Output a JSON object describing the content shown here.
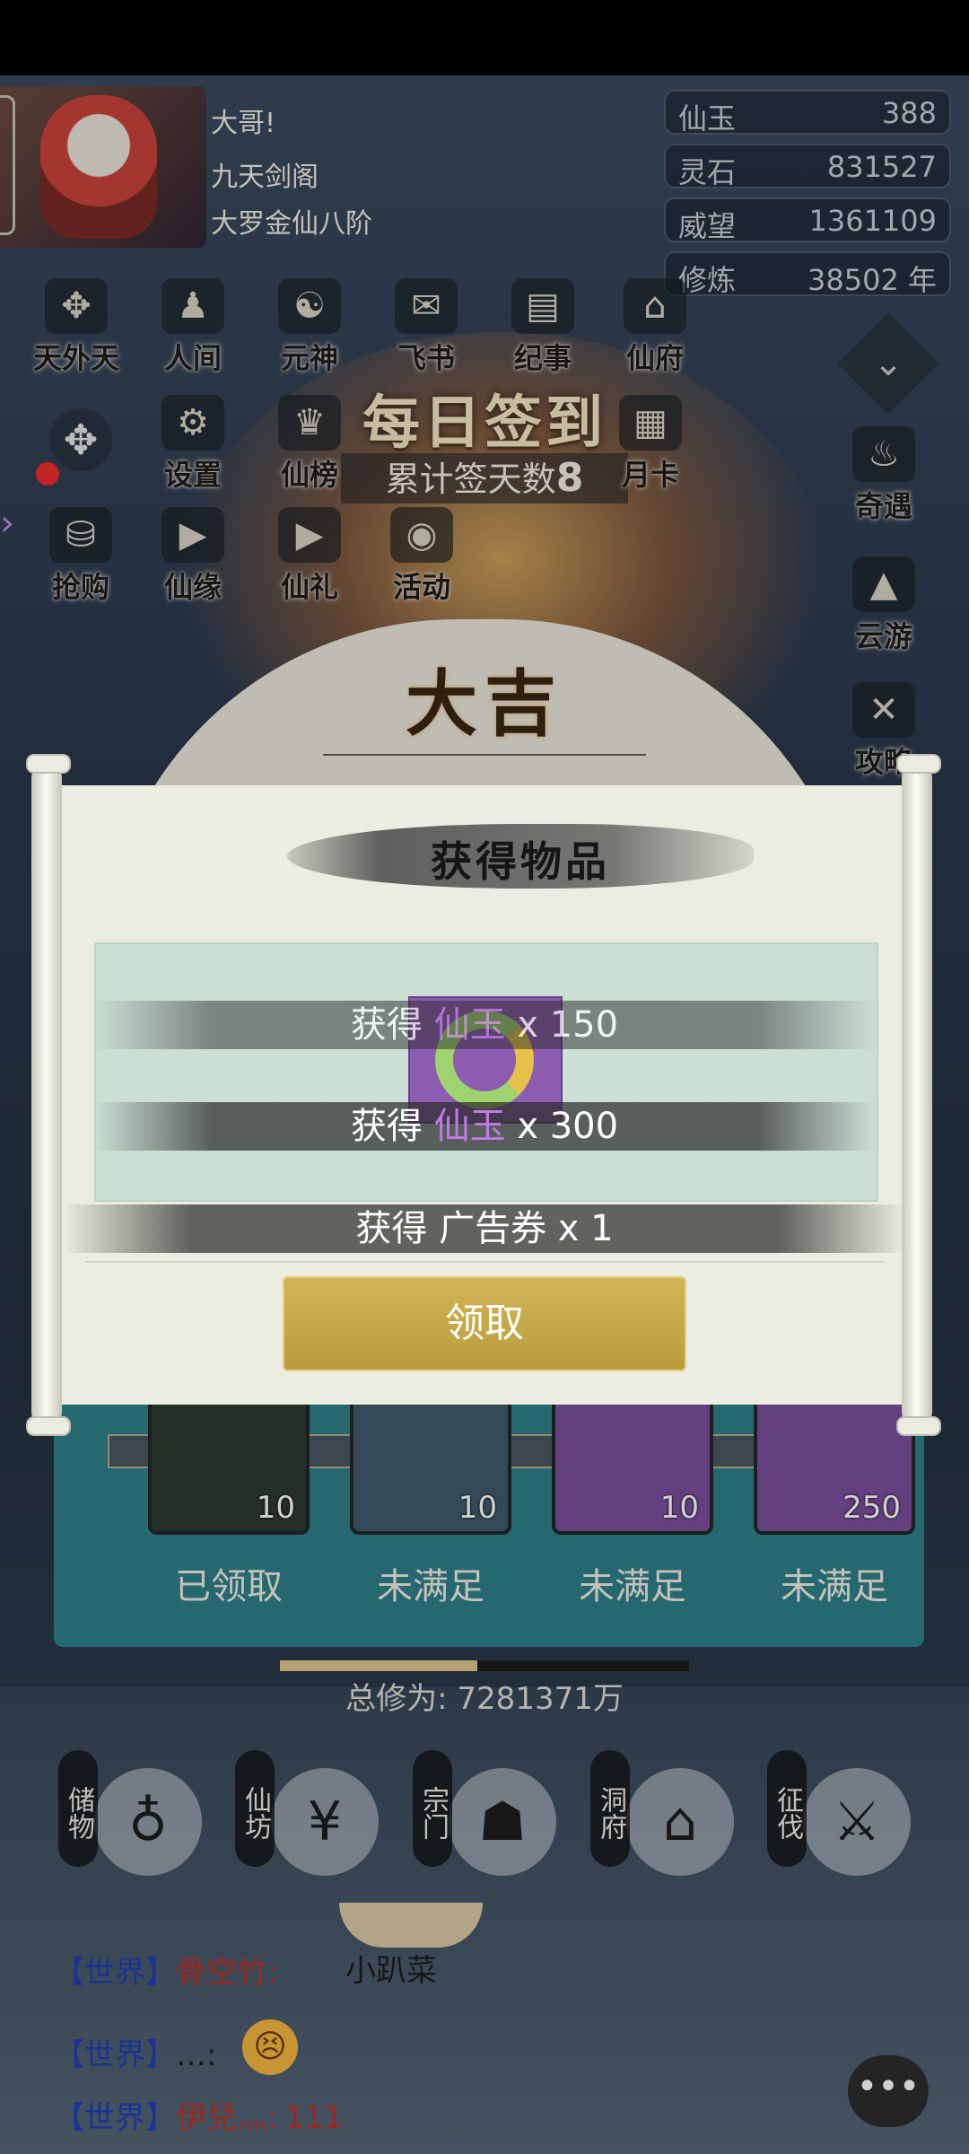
{
  "player": {
    "greeting": "大哥!",
    "sect": "九天剑阁",
    "realm": "大罗金仙八阶"
  },
  "resources": [
    {
      "label": "仙玉",
      "value": "388"
    },
    {
      "label": "灵石",
      "value": "831527"
    },
    {
      "label": "威望",
      "value": "1361109"
    },
    {
      "label": "修炼",
      "value": "38502 年"
    }
  ],
  "menu": {
    "row1": [
      "天外天",
      "人间",
      "元神",
      "飞书",
      "纪事",
      "仙府"
    ],
    "row2": [
      "设置",
      "仙榜",
      "月卡"
    ],
    "row3": [
      "抢购",
      "仙缘",
      "仙礼",
      "活动"
    ],
    "right": [
      "奇遇",
      "云游",
      "攻略"
    ]
  },
  "signin": {
    "title": "每日签到",
    "count_label": "累计签天数",
    "count": "8",
    "fortune": "大吉"
  },
  "rewards_track": {
    "items": [
      {
        "count": "10",
        "status": "已领取"
      },
      {
        "count": "10",
        "status": "未满足"
      },
      {
        "count": "10",
        "status": "未满足"
      },
      {
        "count": "250",
        "status": "未满足"
      }
    ],
    "total_label": "总修为: 7281371万"
  },
  "bottom_nav": [
    {
      "label": "储物"
    },
    {
      "label": "仙坊"
    },
    {
      "label": "宗门"
    },
    {
      "label": "洞府"
    },
    {
      "label": "征伐"
    }
  ],
  "chat": [
    {
      "channel": "【世界】",
      "name": "骨空竹:",
      "msg": "小趴菜"
    },
    {
      "channel": "【世界】",
      "name": "…:",
      "msg": ""
    },
    {
      "channel": "【世界】",
      "name": "伊兒灬:",
      "msg": "111"
    }
  ],
  "modal": {
    "title": "获得物品",
    "lines": [
      {
        "prefix": "获得",
        "item": "仙玉",
        "qty": "x 150"
      },
      {
        "prefix": "获得",
        "item": "仙玉",
        "qty": "x 300"
      },
      {
        "prefix": "获得",
        "item": "广告券",
        "qty": "x 1"
      }
    ],
    "claim_label": "领取"
  },
  "colors": {
    "accent_gold": "#c9ac4a",
    "purple_item": "#8b5cb0",
    "chat_channel": "#1f3fb5",
    "chat_name": "#c0312b"
  }
}
